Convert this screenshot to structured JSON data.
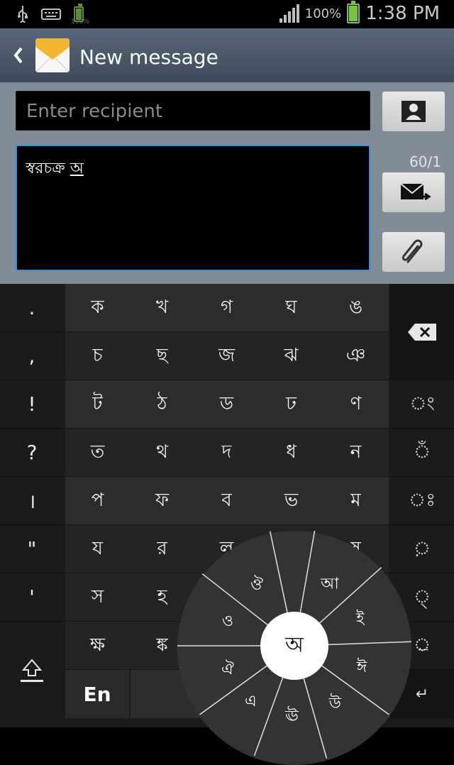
{
  "status_bar": {
    "battery_percent": "100%",
    "time": "1:38 PM",
    "small_battery_label": "100%"
  },
  "title_bar": {
    "title": "New message"
  },
  "compose": {
    "recipient_placeholder": "Enter recipient",
    "message_text_prefix": "স্বরচক্র ",
    "message_text_underlined": "অ",
    "counter": "60/1"
  },
  "keyboard": {
    "punctuation": [
      ".",
      ",",
      "!",
      "?",
      "।",
      "\"",
      "'"
    ],
    "rows": [
      [
        "ক",
        "খ",
        "গ",
        "ঘ",
        "ঙ"
      ],
      [
        "চ",
        "ছ",
        "জ",
        "ঝ",
        "ঞ"
      ],
      [
        "ট",
        "ঠ",
        "ড",
        "ঢ",
        "ণ"
      ],
      [
        "ত",
        "থ",
        "দ",
        "ধ",
        "ন"
      ],
      [
        "প",
        "ফ",
        "ব",
        "ভ",
        "ম"
      ],
      [
        "য",
        "র",
        "ল",
        "",
        "ষ"
      ],
      [
        "স",
        "হ",
        "",
        "",
        ""
      ],
      [
        "ক্ষ",
        "ঙ্ক",
        "",
        "",
        ""
      ]
    ],
    "right_keys": [
      "◌ং",
      "◌ঁ",
      "◌ঃ",
      "◌়",
      "◌্",
      "◌্র"
    ],
    "lang_button": "En",
    "enter_symbol": "↵",
    "vowel_wheel": {
      "center": "অ",
      "items": [
        "আ",
        "ই",
        "ঈ",
        "উ",
        "ঊ",
        "এ",
        "ঐ",
        "ও",
        "ঔ"
      ]
    }
  },
  "colors": {
    "title_bar": "#4c586a",
    "compose_bg": "#828b98",
    "focus_border": "#2e95d6",
    "keyboard_bg": "#1b1b1b"
  }
}
